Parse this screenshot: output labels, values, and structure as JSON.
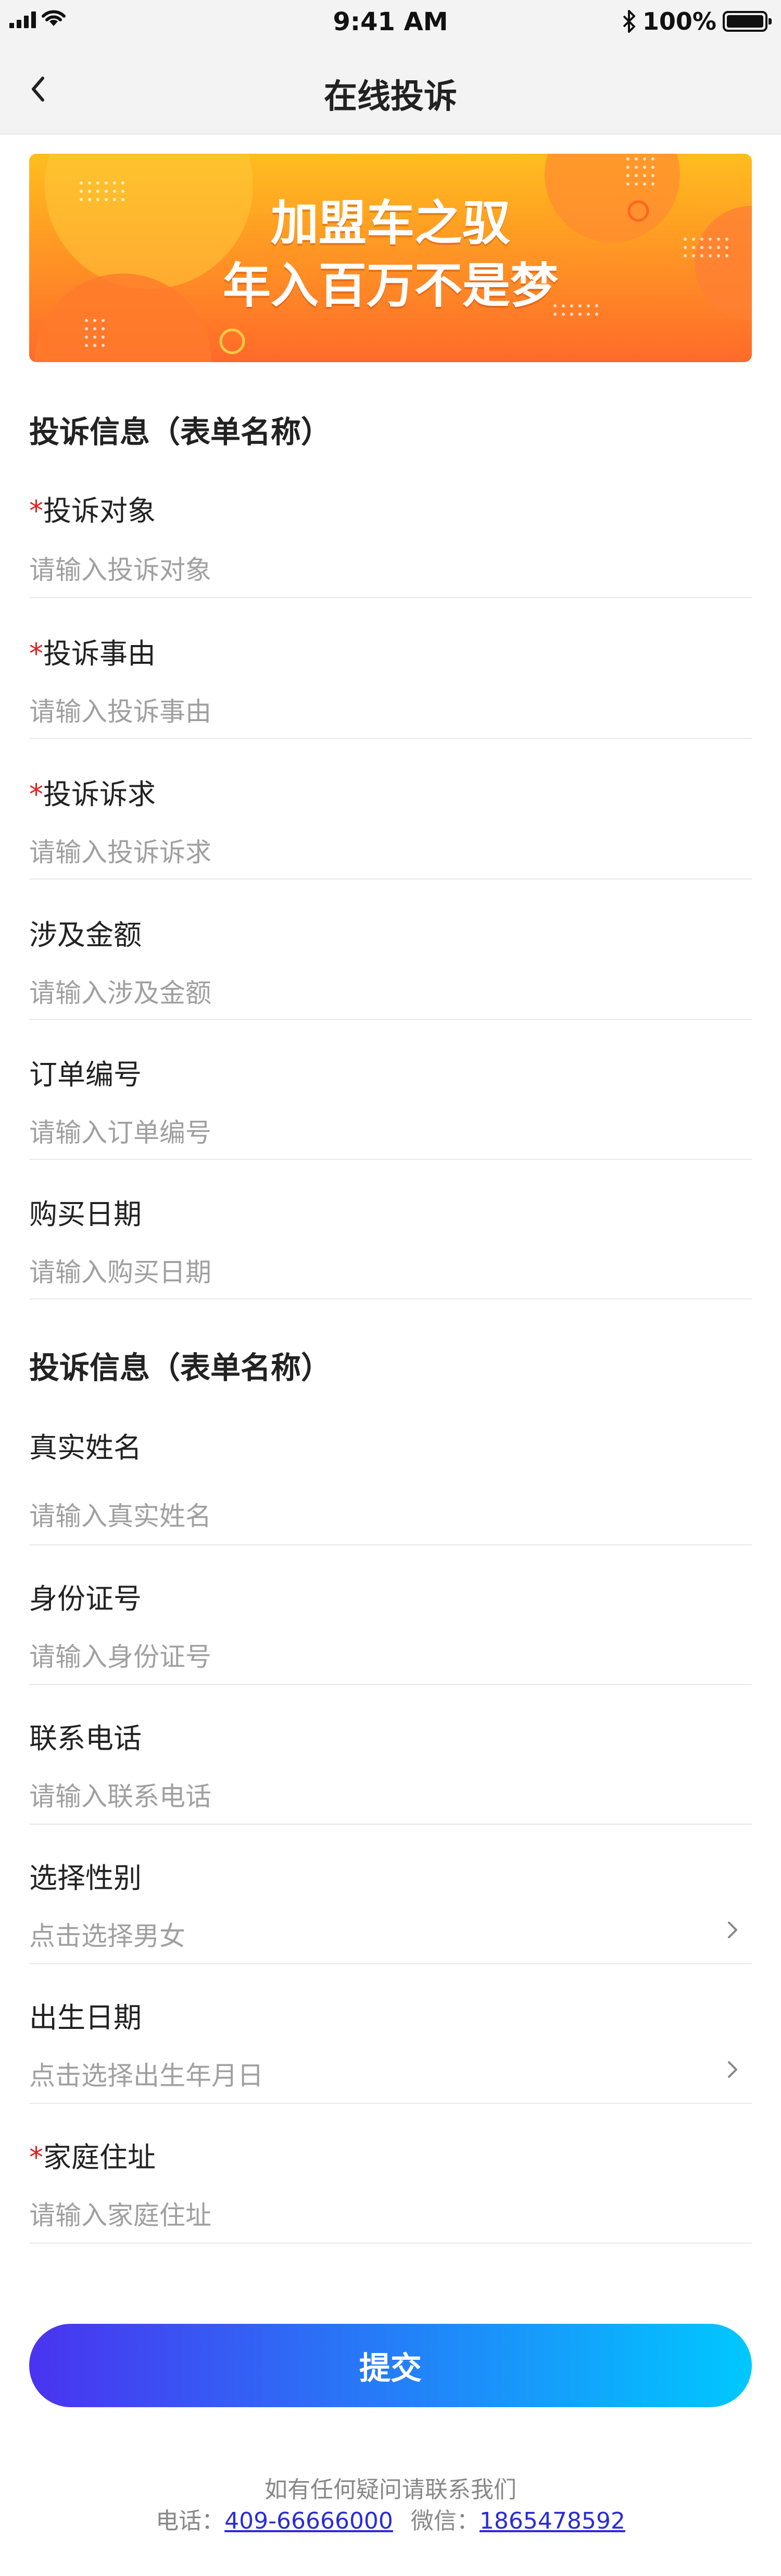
{
  "status_bar": {
    "time": "9:41 AM",
    "battery": "100%"
  },
  "nav": {
    "title": "在线投诉"
  },
  "banner": {
    "line1": "加盟车之驭",
    "line2": "年入百万不是梦"
  },
  "section1": {
    "title": "投诉信息（表单名称）",
    "fields": [
      {
        "label": "投诉对象",
        "required": "*",
        "placeholder": "请输入投诉对象"
      },
      {
        "label": "投诉事由",
        "required": "*",
        "placeholder": "请输入投诉事由"
      },
      {
        "label": "投诉诉求",
        "required": "*",
        "placeholder": "请输入投诉诉求"
      },
      {
        "label": "涉及金额",
        "placeholder": "请输入涉及金额"
      },
      {
        "label": "订单编号",
        "placeholder": "请输入订单编号"
      },
      {
        "label": "购买日期",
        "placeholder": "请输入购买日期"
      }
    ]
  },
  "section2": {
    "title": "投诉信息（表单名称）",
    "fields": [
      {
        "label": "真实姓名",
        "placeholder": "请输入真实姓名"
      },
      {
        "label": "身份证号",
        "placeholder": "请输入身份证号"
      },
      {
        "label": "联系电话",
        "placeholder": "请输入联系电话"
      },
      {
        "label": "选择性别",
        "placeholder": "点击选择男女"
      },
      {
        "label": "出生日期",
        "placeholder": "点击选择出生年月日"
      },
      {
        "label": "家庭住址",
        "required": "*",
        "placeholder": "请输入家庭住址"
      }
    ]
  },
  "submit_label": "提交",
  "footer": {
    "line1": "如有任何疑问请联系我们",
    "phone_label": "电话：",
    "phone": "409-66666000",
    "wechat_label": "微信：",
    "wechat": "1865478592"
  },
  "colors": {
    "accent_start": "#4a33f0",
    "accent_end": "#00c8ff",
    "required": "#e02020",
    "banner": "#ff8a25"
  },
  "icons": [
    "signal-icon",
    "wifi-icon",
    "bluetooth-icon",
    "battery-icon",
    "back-arrow-icon",
    "chevron-right-icon"
  ]
}
